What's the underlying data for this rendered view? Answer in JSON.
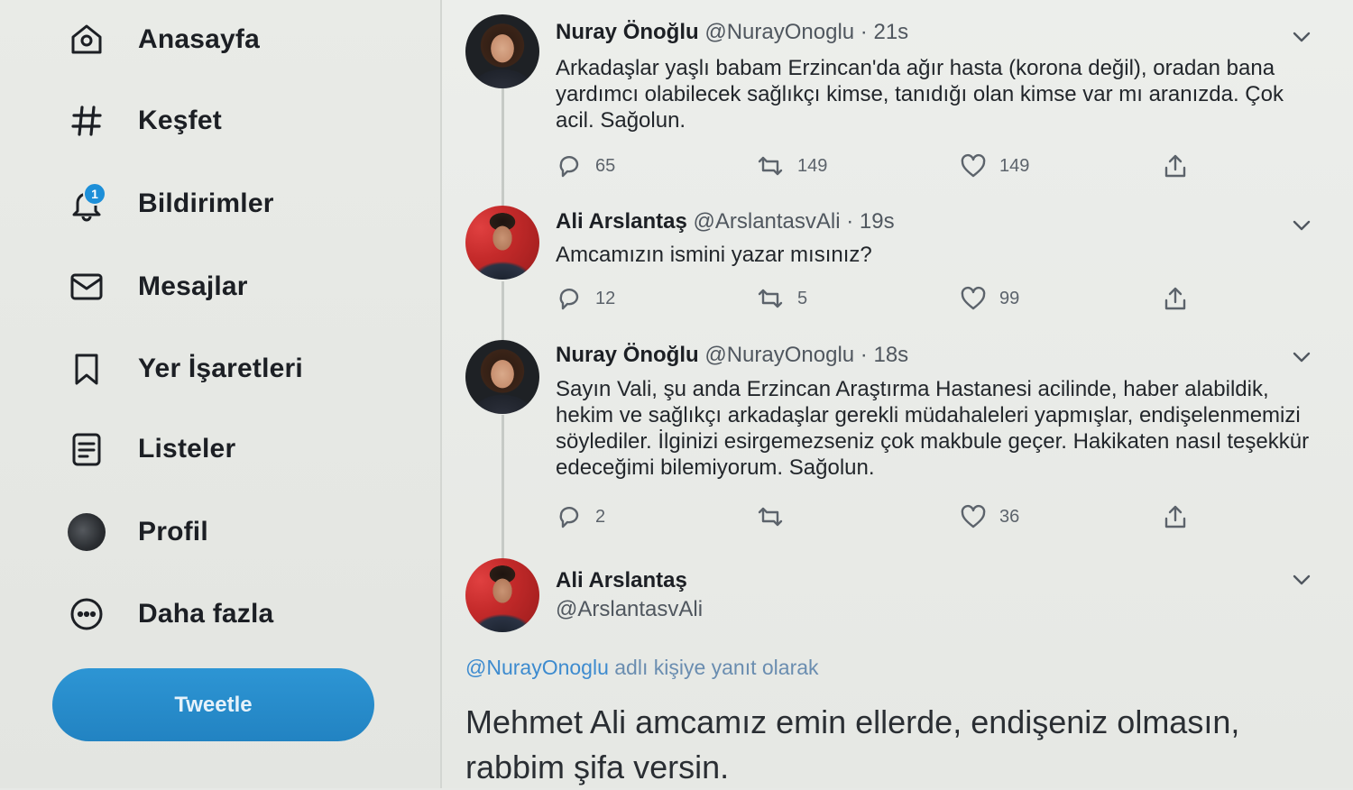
{
  "sidebar": {
    "items": [
      {
        "label": "Anasayfa",
        "icon": "home-icon"
      },
      {
        "label": "Keşfet",
        "icon": "hashtag-icon"
      },
      {
        "label": "Bildirimler",
        "icon": "bell-icon",
        "badge": "1"
      },
      {
        "label": "Mesajlar",
        "icon": "mail-icon"
      },
      {
        "label": "Yer İşaretleri",
        "icon": "bookmark-icon"
      },
      {
        "label": "Listeler",
        "icon": "list-icon"
      },
      {
        "label": "Profil",
        "icon": "profile-avatar"
      },
      {
        "label": "Daha fazla",
        "icon": "more-icon"
      }
    ],
    "tweet_button": "Tweetle"
  },
  "tweets": [
    {
      "name": "Nuray Önoğlu",
      "handle": "@NurayOnoglu",
      "time": "21s",
      "text": "Arkadaşlar yaşlı babam Erzincan'da ağır hasta (korona değil), oradan bana yardımcı olabilecek sağlıkçı kimse, tanıdığı olan kimse var mı aranızda. Çok acil. Sağolun.",
      "replies": "65",
      "retweets": "149",
      "likes": "149"
    },
    {
      "name": "Ali Arslantaş",
      "handle": "@ArslantasvAli",
      "time": "19s",
      "text": "Amcamızın ismini yazar mısınız?",
      "replies": "12",
      "retweets": "5",
      "likes": "99"
    },
    {
      "name": "Nuray Önoğlu",
      "handle": "@NurayOnoglu",
      "time": "18s",
      "text": "Sayın Vali, şu anda Erzincan Araştırma Hastanesi acilinde, haber alabildik, hekim ve sağlıkçı arkadaşlar gerekli müdahaleleri yapmışlar, endişelenmemizi söylediler. İlginizi esirgemezseniz çok makbule geçer. Hakikaten nasıl teşekkür edeceğimi bilemiyorum. Sağolun.",
      "replies": "2",
      "retweets": "",
      "likes": "36"
    }
  ],
  "focus_tweet": {
    "name": "Ali Arslantaş",
    "handle": "@ArslantasvAli",
    "reply_mention": "@NurayOnoglu",
    "reply_suffix": " adlı kişiye yanıt olarak",
    "text": "Mehmet Ali amcamız emin ellerde, endişeniz olmasın, rabbim şifa versin."
  },
  "colors": {
    "accent": "#1d8fd8",
    "tweet_button": "#2283c2",
    "text": "#1c1f24",
    "muted": "#50575f"
  }
}
